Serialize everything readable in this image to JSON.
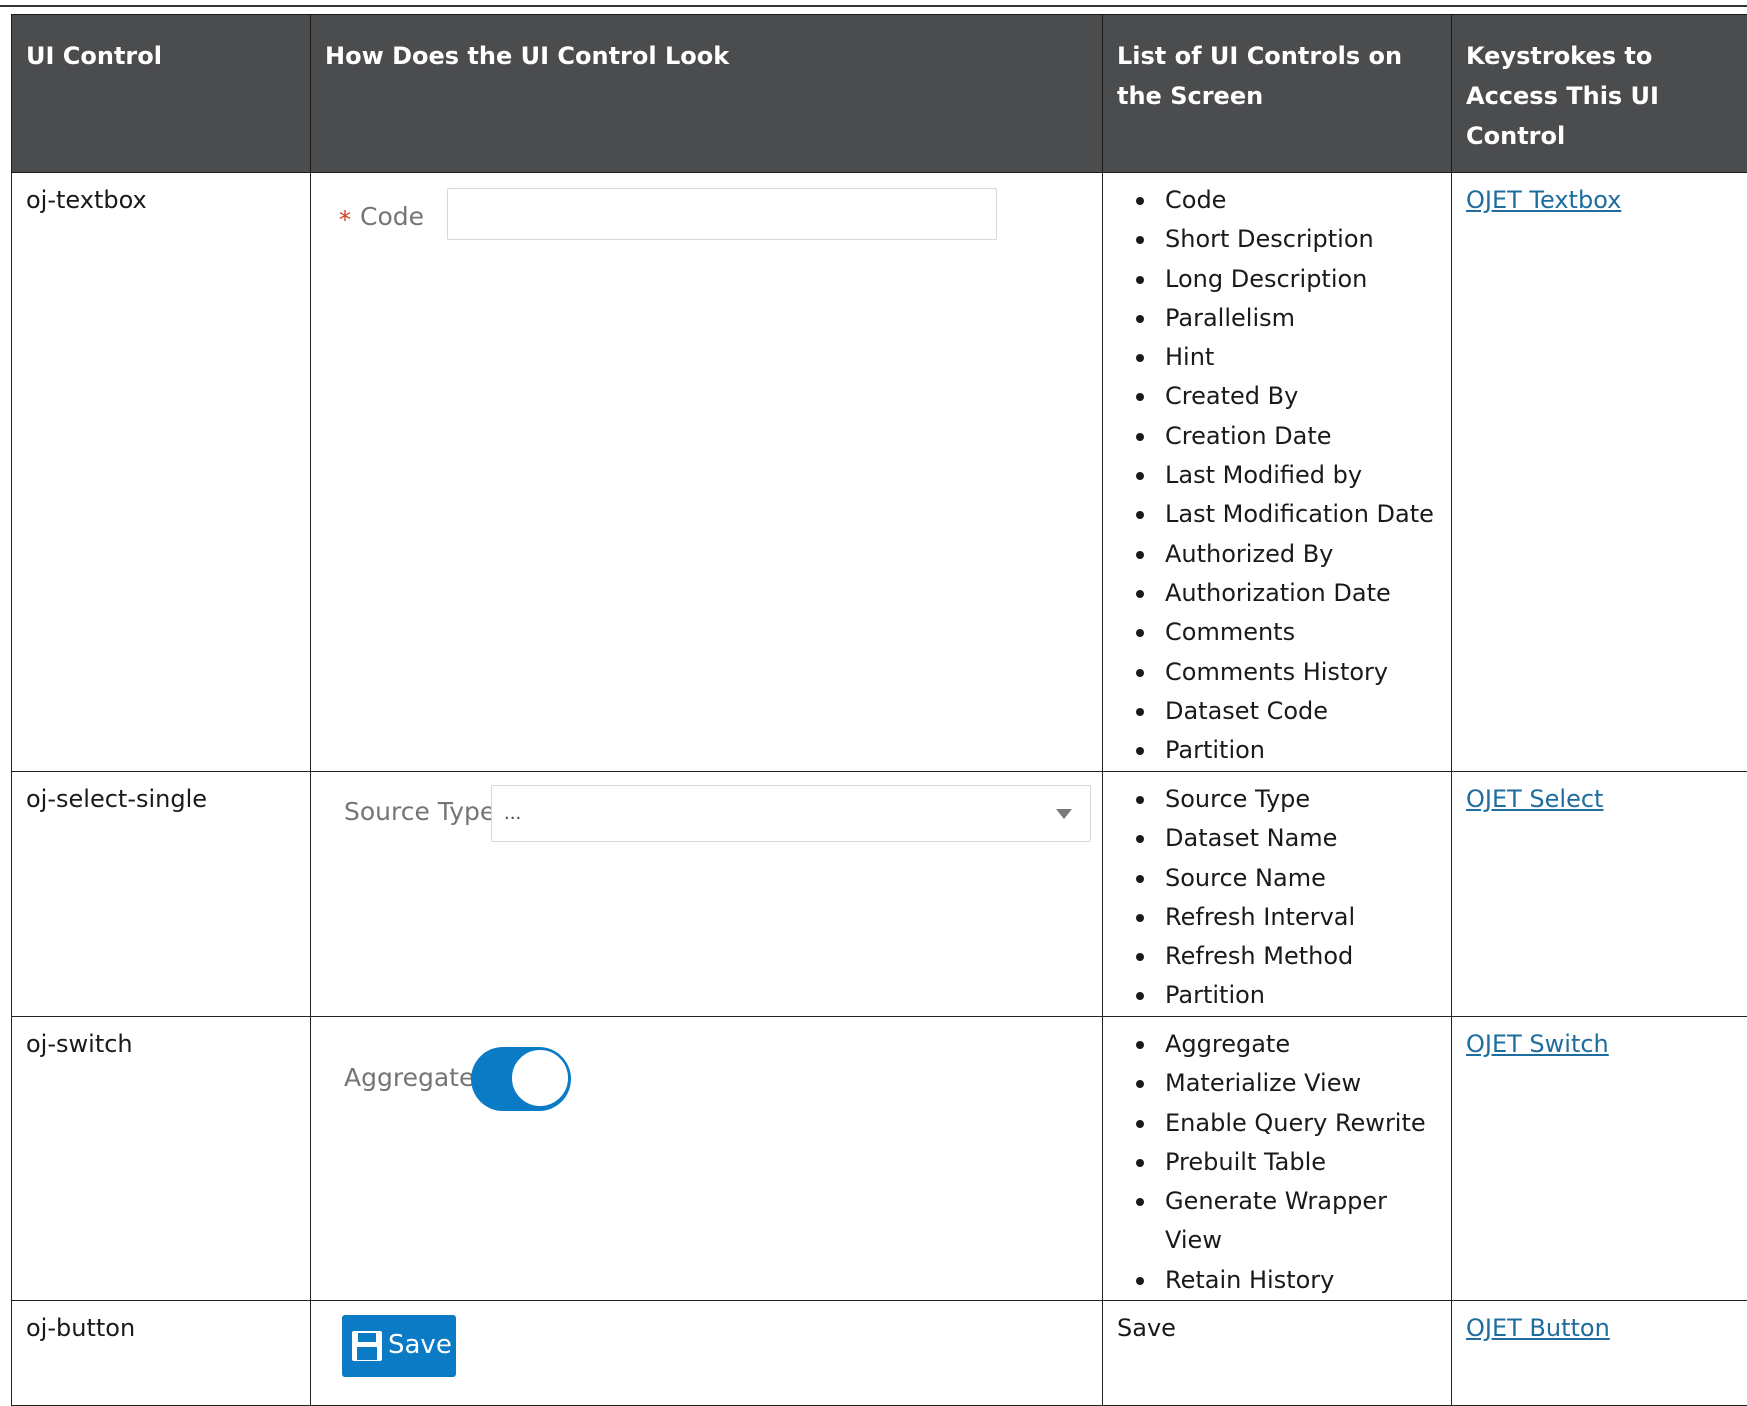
{
  "headers": [
    "UI Control",
    "How Does the UI Control Look",
    "List of UI Controls on the Screen",
    "Keystrokes to Access This UI Control"
  ],
  "rows": [
    {
      "ui_control": "oj-textbox",
      "mock": {
        "required_marker": "*",
        "label": "Code",
        "value": ""
      },
      "controls": [
        "Code",
        "Short Description",
        "Long Description",
        "Parallelism",
        "Hint",
        "Created By",
        "Creation Date",
        "Last Modified by",
        "Last Modification Date",
        "Authorized By",
        "Authorization Date",
        "Comments",
        "Comments History",
        "Dataset Code",
        "Partition"
      ],
      "link": "OJET Textbox"
    },
    {
      "ui_control": "oj-select-single",
      "mock": {
        "label": "Source Type",
        "value": "...",
        "icon": "chevron-down-icon"
      },
      "controls": [
        "Source Type",
        "Dataset Name",
        "Source Name",
        "Refresh Interval",
        "Refresh Method",
        "Partition"
      ],
      "link": "OJET Select"
    },
    {
      "ui_control": "oj-switch",
      "mock": {
        "label": "Aggregate",
        "state": "on",
        "accent": "#0a7bc4"
      },
      "controls": [
        "Aggregate",
        "Materialize View",
        "Enable Query Rewrite",
        "Prebuilt Table",
        "Generate Wrapper View",
        "Retain History"
      ],
      "link": "OJET Switch"
    },
    {
      "ui_control": "oj-button",
      "mock": {
        "label": "Save",
        "icon": "save-icon",
        "accent": "#0a7bc4"
      },
      "controls_text": "Save",
      "link": "OJET Button"
    }
  ]
}
